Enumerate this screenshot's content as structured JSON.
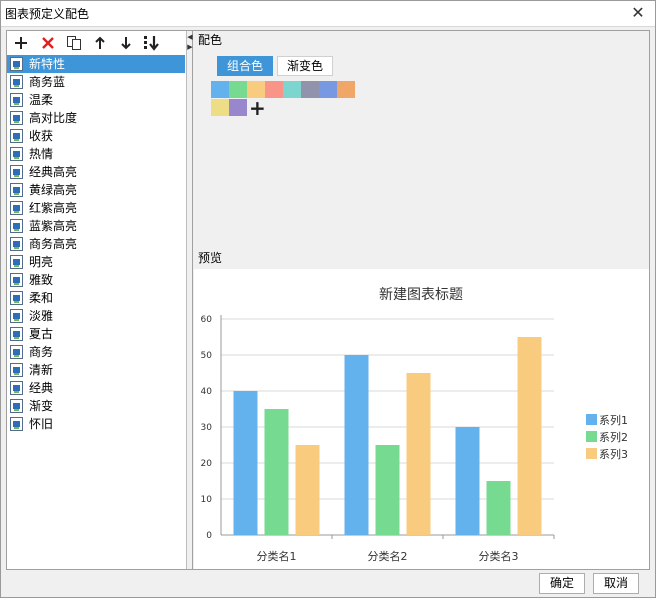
{
  "window": {
    "title": "图表预定义配色",
    "close_glyph": "✕"
  },
  "toolbar": {
    "add_icon": "plus-icon",
    "delete_icon": "delete-icon",
    "copy_icon": "copy-icon",
    "up_icon": "arrow-up-icon",
    "down_icon": "arrow-down-icon",
    "bottom_icon": "move-to-bottom-icon"
  },
  "scheme_list": [
    "新特性",
    "商务蓝",
    "温柔",
    "高对比度",
    "收获",
    "热情",
    "经典高亮",
    "黄绿高亮",
    "红紫高亮",
    "蓝紫高亮",
    "商务高亮",
    "明亮",
    "雅致",
    "柔和",
    "淡雅",
    "夏古",
    "商务",
    "清新",
    "经典",
    "渐变",
    "怀旧"
  ],
  "selected_index": 0,
  "color_section": {
    "label": "配色",
    "tabs": [
      "组合色",
      "渐变色"
    ],
    "active_tab": 0,
    "colors": [
      "#63b2ee",
      "#76da91",
      "#f8cb7f",
      "#f89588",
      "#7cd6cf",
      "#9192ab",
      "#7898e1",
      "#efa666",
      "#eddd86",
      "#9987ce"
    ],
    "add_glyph": "+"
  },
  "preview": {
    "label": "预览"
  },
  "chart_data": {
    "type": "bar",
    "title": "新建图表标题",
    "categories": [
      "分类名1",
      "分类名2",
      "分类名3"
    ],
    "series": [
      {
        "name": "系列1",
        "values": [
          40,
          50,
          30
        ],
        "color": "#63b2ee"
      },
      {
        "name": "系列2",
        "values": [
          35,
          25,
          15
        ],
        "color": "#76da91"
      },
      {
        "name": "系列3",
        "values": [
          25,
          45,
          55
        ],
        "color": "#f8cb7f"
      }
    ],
    "yticks": [
      "0",
      "10",
      "20",
      "30",
      "40",
      "50",
      "60"
    ],
    "ylim": [
      0,
      60
    ],
    "grid": true,
    "legend": "right"
  },
  "buttons": {
    "ok": "确定",
    "cancel": "取消"
  }
}
